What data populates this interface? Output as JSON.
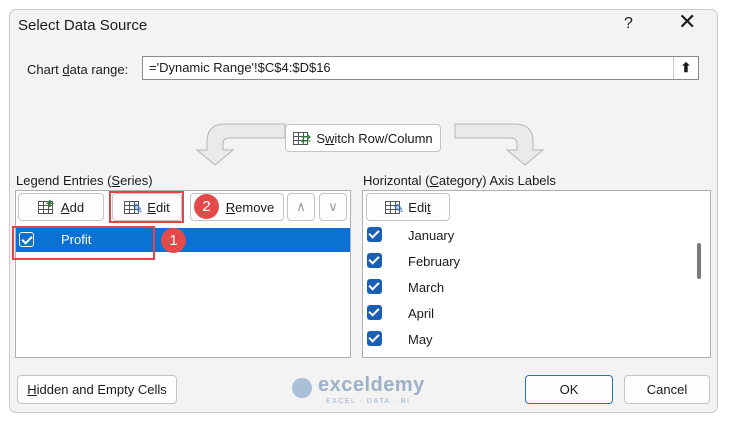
{
  "dialog": {
    "title": "Select Data Source",
    "help_icon": "?",
    "close_icon": "✕"
  },
  "range": {
    "label_pre": "Chart ",
    "label_u": "d",
    "label_post": "ata range:",
    "value": "='Dynamic Range'!$C$4:$D$16",
    "collapse_icon": "⬆"
  },
  "switch_button": {
    "pre": "S",
    "u": "w",
    "post": "itch Row/Column"
  },
  "legend": {
    "label_pre": "Legend Entries (",
    "label_u": "S",
    "label_post": "eries)",
    "add_u": "A",
    "add_post": "dd",
    "edit_u": "E",
    "edit_post": "dit",
    "remove_u": "R",
    "remove_post": "emove",
    "move_up_icon": "∧",
    "move_down_icon": "∨",
    "series": [
      {
        "name": "Profit",
        "checked": true,
        "selected": true
      }
    ]
  },
  "axis": {
    "label_pre": "Horizontal (",
    "label_u": "C",
    "label_post": "ategory) Axis Labels",
    "edit_pre": "Edi",
    "edit_u": "t",
    "items": [
      {
        "label": "January",
        "checked": true
      },
      {
        "label": "February",
        "checked": true
      },
      {
        "label": "March",
        "checked": true
      },
      {
        "label": "April",
        "checked": true
      },
      {
        "label": "May",
        "checked": true
      }
    ]
  },
  "footer": {
    "hidden_u": "H",
    "hidden_post": "idden and Empty Cells",
    "ok": "OK",
    "cancel": "Cancel"
  },
  "annotations": {
    "badge1": "1",
    "badge2": "2",
    "annotation_color": "#e04848"
  },
  "watermark": {
    "name": "exceldemy",
    "tagline": "EXCEL · DATA · BI"
  },
  "colors": {
    "selection": "#0b71d3",
    "checkbox": "#1a5fb4"
  }
}
